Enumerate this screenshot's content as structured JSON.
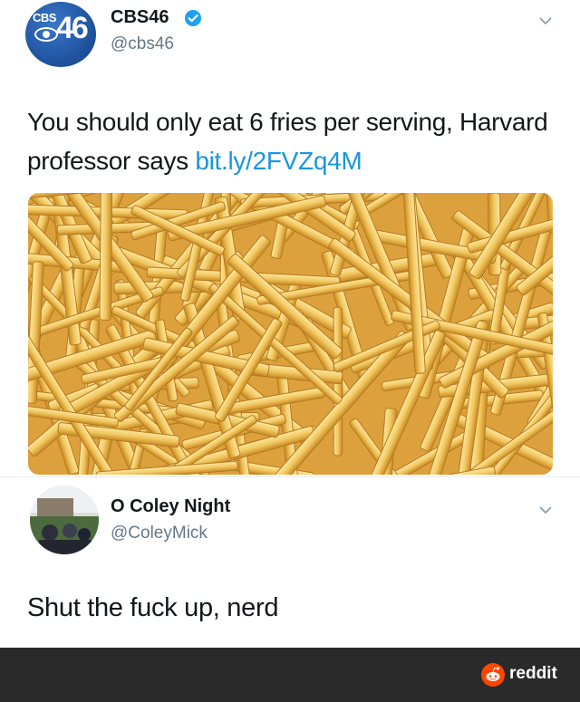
{
  "tweet": {
    "author_name": "CBS46",
    "author_handle": "@cbs46",
    "avatar_text": "CBS",
    "avatar_number": "46",
    "text": "You should only eat 6 fries per serving, Harvard professor says ",
    "link": "bit.ly/2FVZq4M",
    "media_icon": "fries-photo"
  },
  "reply": {
    "author_name": "O Coley Night",
    "author_handle": "@ColeyMick",
    "text": "Shut the fuck up, nerd"
  },
  "watermark": {
    "label": "reddit",
    "icon": "reddit-icon",
    "color": "#ff4500"
  },
  "colors": {
    "link": "#1b95e0",
    "handle": "#657786",
    "verified": "#1da1f2",
    "footer_bg": "#2a2a2a"
  }
}
